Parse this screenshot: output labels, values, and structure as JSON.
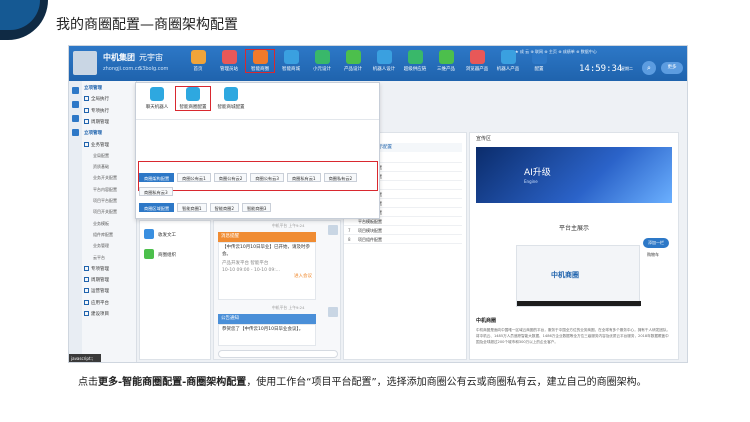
{
  "page_title": "我的商圈配置—商圈架构配置",
  "topbar": {
    "company": "中机集团",
    "company_sub": "zhongji.com.cn",
    "meta": "元宇宙",
    "meta_sub": "53bolg.com",
    "nav": [
      {
        "label": "首页",
        "color": "#f0a43a"
      },
      {
        "label": "管理员站",
        "color": "#e85858"
      },
      {
        "label": "智能商圈",
        "color": "#f07a2a"
      },
      {
        "label": "智能商城",
        "color": "#3aa0e0"
      },
      {
        "label": "小元设计",
        "color": "#39b86a"
      },
      {
        "label": "产品设计",
        "color": "#4cbf4c"
      },
      {
        "label": "机器人设计",
        "color": "#3aa0e0"
      },
      {
        "label": "超级供应链",
        "color": "#39b86a"
      },
      {
        "label": "三维产品",
        "color": "#4cbf4c"
      },
      {
        "label": "浏览器产品",
        "color": "#e85858"
      },
      {
        "label": "机器人产品",
        "color": "#3aa0e0"
      },
      {
        "label": "配置",
        "color": "#2d78c7"
      }
    ],
    "right_links": "★ 成 云 ⊕ 联网 ⊕ 主页 ⊕ 成绩单 ⊕ 数据中心",
    "clock": "14:59:34",
    "weekday": "星期二",
    "more": "更多"
  },
  "sidebar": {
    "items": [
      {
        "label": "立项管理",
        "kind": "hdr"
      },
      {
        "label": "全局执行",
        "kind": "chk"
      },
      {
        "label": "专项执行",
        "kind": "chk"
      },
      {
        "label": "周期管理",
        "kind": "chk"
      },
      {
        "label": "立项管理",
        "kind": "hdr"
      },
      {
        "label": "业务管理",
        "kind": "chk"
      },
      {
        "label": "全局配置",
        "kind": "sub"
      },
      {
        "label": "资质基础",
        "kind": "sub"
      },
      {
        "label": "业务开关配置",
        "kind": "sub"
      },
      {
        "label": "平台内容配置",
        "kind": "sub"
      },
      {
        "label": "项目平台配置",
        "kind": "sub"
      },
      {
        "label": "项目开关配置",
        "kind": "sub"
      },
      {
        "label": "业务模板",
        "kind": "sub"
      },
      {
        "label": "组件库配置",
        "kind": "sub"
      },
      {
        "label": "业务管理",
        "kind": "sub"
      },
      {
        "label": "云平台",
        "kind": "sub"
      },
      {
        "label": "专项管理",
        "kind": "chk"
      },
      {
        "label": "周期管理",
        "kind": "chk"
      },
      {
        "label": "运营管理",
        "kind": "chk"
      },
      {
        "label": "应用平台",
        "kind": "chk"
      },
      {
        "label": "建设项目",
        "kind": "chk"
      }
    ],
    "status": "javascript:;"
  },
  "dropdown": {
    "icons": [
      {
        "label": "聊天机器人"
      },
      {
        "label": "智能商圈配置"
      },
      {
        "label": "智能商城配置"
      }
    ],
    "row1": [
      "商圈架构配置",
      "商圈公有云1",
      "商圈公有云2",
      "商圈公有云3",
      "商圈私有云1",
      "商圈私有云2"
    ],
    "row2": [
      "商圈私有云3"
    ],
    "row3": [
      "商圈区域配置",
      "智能商圈1",
      "智能商圈2",
      "智能商圈3"
    ]
  },
  "middle": {
    "tiles": [
      {
        "label": "收发文工",
        "color": "#3a8fe0"
      },
      {
        "label": "商圈组织",
        "color": "#4cbf4c"
      }
    ],
    "msg1_head": "消息提醒",
    "msg1_body": "【中传云10月10日毕业】已开始，请及时参会。",
    "msg1_meta": "产品开发平台  智能平台",
    "msg1_time": "10-10 09:00 - 10-10 09:...",
    "msg1_link": "进入会议",
    "msg2_head": "公告通知",
    "msg2_body": "恭贺您了【中传云10月10日毕业会议】。",
    "sender": "中机平台  上午9:24"
  },
  "list": {
    "header": "标示配置",
    "rows": [
      {
        "n": "",
        "label": "可选配置"
      },
      {
        "n": "",
        "label": "可选模板配置"
      },
      {
        "n": "",
        "label": "可选模板配置"
      },
      {
        "n": "",
        "label": "模板配置"
      },
      {
        "n": "",
        "label": "模板项目配置"
      },
      {
        "n": "",
        "label": "产品目录配置"
      },
      {
        "n": "",
        "label": "业务模板配置"
      },
      {
        "n": "",
        "label": "平台模板配置"
      },
      {
        "n": "7",
        "label": "项目模块配置"
      },
      {
        "n": "8",
        "label": "项目组件配置"
      }
    ]
  },
  "right": {
    "header": "宣传区",
    "banner_title": "AI升级",
    "banner_sub": "Engine",
    "section": "平台主展示",
    "video_logo": "中机商圈",
    "float1": "添加一栏",
    "float2": "购物车",
    "desc_title": "中机商圈",
    "desc_body": "中机商圈是面向中国唯一区域云商圈的平台，服务于中国全方位的业务商圈，在全球有多个服务中心，拥有千人研发团队。将中机云、1485万人员追踪智能大数据、1486万企业数据等全方位三级服务内容及优质云平台服务，2018年数据覆盖中国及全球超过200个城市和300万以上的企业客户。"
  },
  "caption": {
    "prefix": "点击",
    "path": "更多-智能商圈配置-商圈架构配置",
    "rest": "，使用工作台“项目平台配置”，选择添加商圈公有云或商圈私有云，建立自己的商圈架构。"
  }
}
